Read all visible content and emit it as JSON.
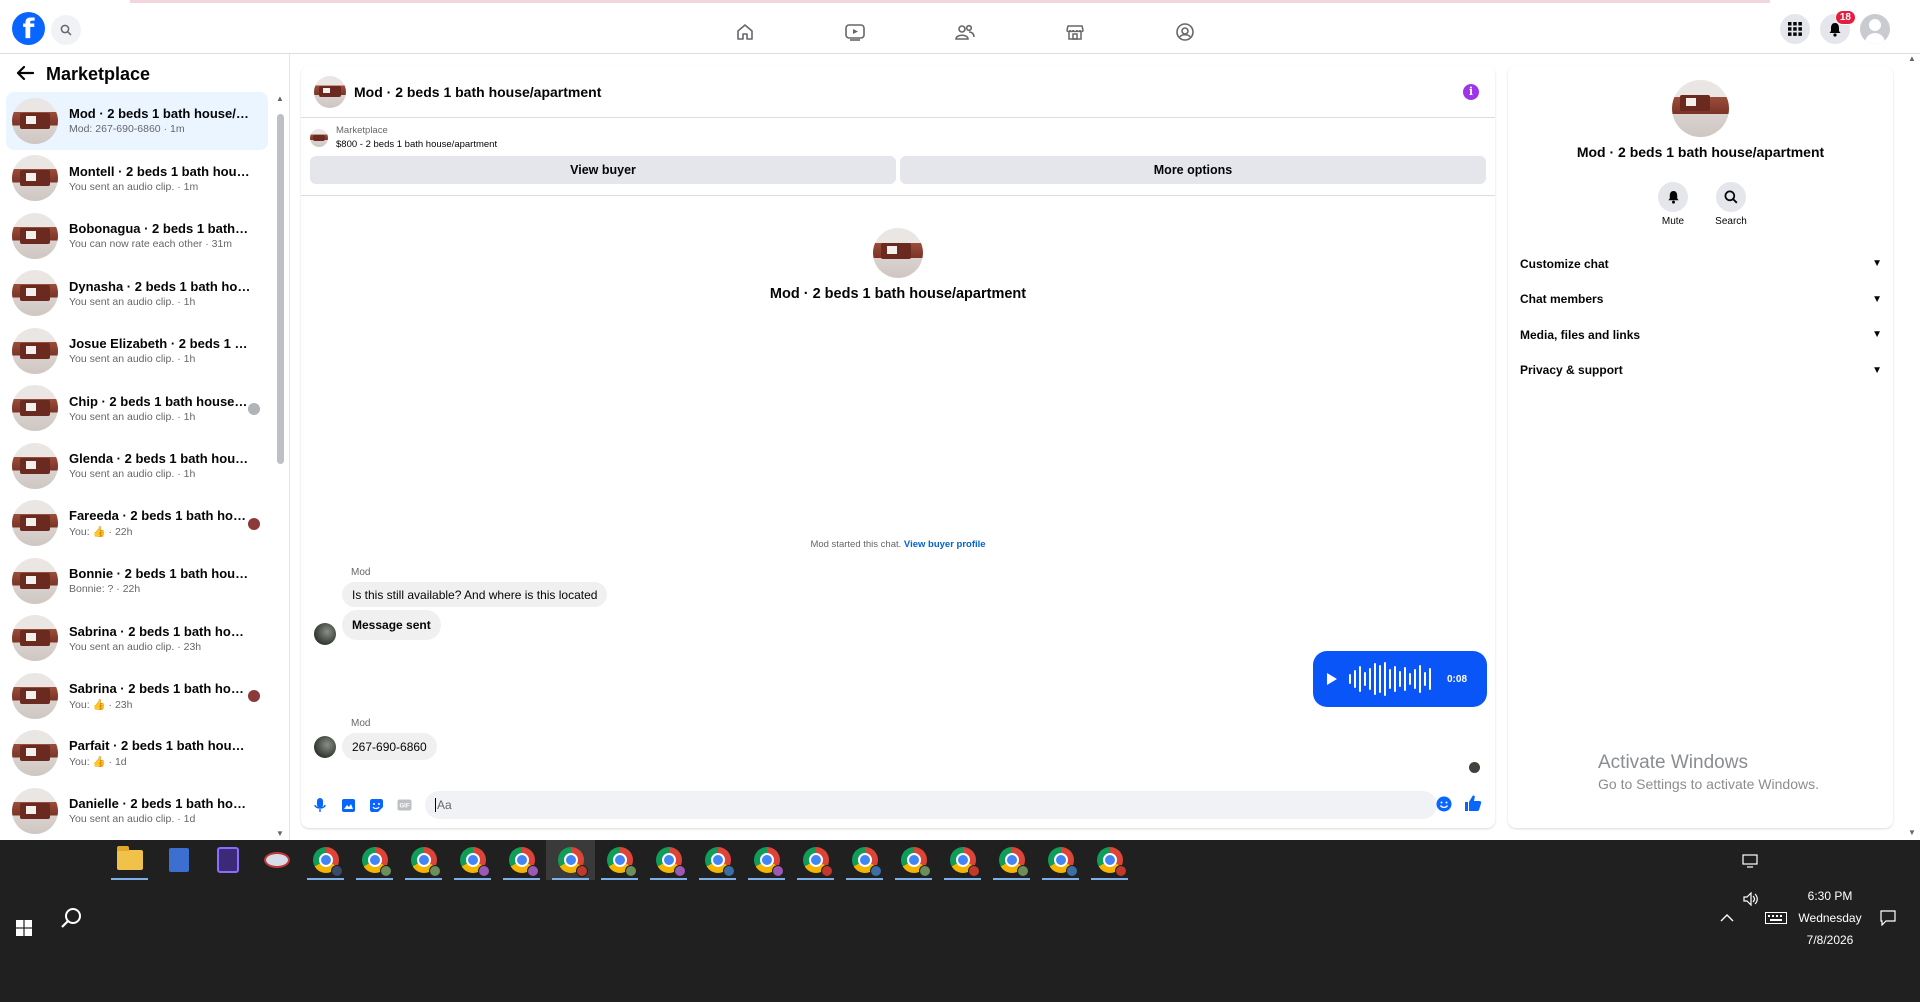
{
  "topnav": {
    "logo": "f",
    "notif_count": "18"
  },
  "sidebar": {
    "title": "Marketplace",
    "conversations": [
      {
        "name": "Mod · 2 beds 1 bath house/apar...",
        "sub": "Mod: 267-690-6860 · 1m"
      },
      {
        "name": "Montell · 2 beds 1 bath house/a...",
        "sub": "You sent an audio clip. · 1m"
      },
      {
        "name": "Bobonagua · 2 beds 1 bath hou...",
        "sub": "You can now rate each other · 31m"
      },
      {
        "name": "Dynasha · 2 beds 1 bath house/...",
        "sub": "You sent an audio clip. · 1h"
      },
      {
        "name": "Josue Elizabeth · 2 beds 1 bath ...",
        "sub": "You sent an audio clip. · 1h"
      },
      {
        "name": "Chip · 2 beds 1 bath house/ap...",
        "sub": "You sent an audio clip. · 1h"
      },
      {
        "name": "Glenda · 2 beds 1 bath house/a...",
        "sub": "You sent an audio clip. · 1h"
      },
      {
        "name": "Fareeda · 2 beds 1 bath house...",
        "sub": "You: 👍 · 22h"
      },
      {
        "name": "Bonnie · 2 beds 1 bath house/a...",
        "sub": "Bonnie: ? · 22h"
      },
      {
        "name": "Sabrina · 2 beds 1 bath house/a...",
        "sub": "You sent an audio clip. · 23h"
      },
      {
        "name": "Sabrina · 2 beds 1 bath house...",
        "sub": "You: 👍 · 23h"
      },
      {
        "name": "Parfait · 2 beds 1 bath house/ap...",
        "sub": "You: 👍 · 1d"
      },
      {
        "name": "Danielle · 2 beds 1 bath house/a...",
        "sub": "You sent an audio clip. · 1d"
      }
    ]
  },
  "chat": {
    "title": "Mod · 2 beds 1 bath house/apartment",
    "listing": {
      "label": "Marketplace",
      "price_title": "$800 - 2 beds 1 bath house/apartment",
      "view_buyer": "View buyer",
      "more_options": "More options"
    },
    "intro_title": "Mod · 2 beds 1 bath house/apartment",
    "started_text": "Mod started this chat.",
    "started_link": "View buyer profile",
    "messages": {
      "sender1": "Mod",
      "msg1": "Is this still available? And where is this located",
      "msg2": "Message sent",
      "audio_time": "0:08",
      "sender2": "Mod",
      "msg3": "267-690-6860"
    },
    "composer_placeholder": "Aa"
  },
  "rpanel": {
    "title": "Mod · 2 beds 1 bath house/apartment",
    "mute": "Mute",
    "search": "Search",
    "menu": [
      "Customize chat",
      "Chat members",
      "Media, files and links",
      "Privacy & support"
    ]
  },
  "watermark": {
    "line1": "Activate Windows",
    "line2": "Go to Settings to activate Windows."
  },
  "taskbar": {
    "time": "6:30 PM",
    "day": "Wednesday",
    "date": "7/8/2026"
  },
  "colors": {
    "fb_blue": "#0866ff",
    "audio_bubble": "#0a55f7",
    "info": "#9d35e8",
    "active_conv": "#ebf5ff"
  }
}
